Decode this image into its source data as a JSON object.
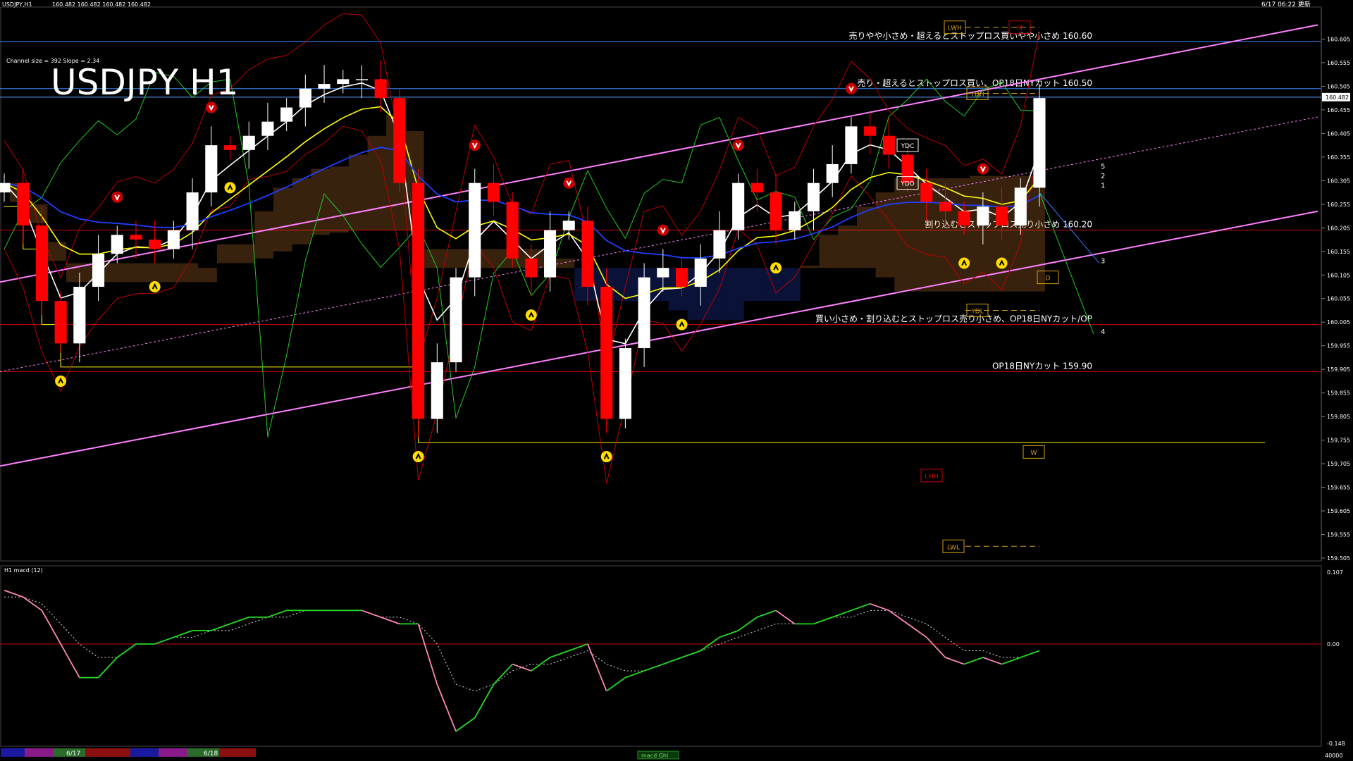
{
  "header": {
    "symbol_info": "USDJPY,H1",
    "ohlc": "160.482 160.482 160.482 160.482",
    "timestamp": "6/17 06:22 更新"
  },
  "main_title": "USDJPY H1",
  "channel_info": "Channel size = 392 Slope = 2.34",
  "colors": {
    "background": "#000000",
    "bull_candle": "#ffffff",
    "bear_candle": "#ff0000",
    "ema_fast": "#ffffff",
    "ema_slow": "#ffff00",
    "ema_long": "#1f3fff",
    "channel": "#ff80ff",
    "cloud_bear": "#ff9a40",
    "cloud_bull": "#3050ff",
    "chikou": "#22cc22",
    "level_line": "#cc0000",
    "macd_pos": "#22dd22",
    "macd_neg": "#ff88bb"
  },
  "chart_data": [
    {
      "type": "line",
      "title": "USDJPY H1",
      "ylim": [
        159.505,
        160.655
      ],
      "y_ticks": [
        "160.605",
        "160.555",
        "160.505",
        "160.455",
        "160.405",
        "160.355",
        "160.305",
        "160.255",
        "160.205",
        "160.155",
        "160.105",
        "160.055",
        "160.005",
        "159.955",
        "159.905",
        "159.855",
        "159.805",
        "159.755",
        "159.705",
        "159.655",
        "159.605",
        "159.555",
        "159.505"
      ],
      "current_price": "160.482",
      "x_labels": [
        "6/17",
        "6/18"
      ],
      "series": [
        {
          "values": [
            160.3,
            160.21,
            160.05,
            159.96,
            160.08,
            160.15,
            160.19,
            160.18,
            160.16,
            160.2,
            160.28,
            160.38,
            160.37,
            160.4,
            160.43,
            160.46,
            160.5,
            160.51,
            160.52,
            160.52,
            160.48,
            160.3,
            159.8,
            159.92,
            160.1,
            160.3,
            160.26,
            160.14,
            160.1,
            160.2,
            160.22,
            160.08,
            159.8,
            159.95,
            160.1,
            160.12,
            160.08,
            160.14,
            160.2,
            160.3,
            160.28,
            160.2,
            160.24,
            160.3,
            160.34,
            160.42,
            160.4,
            160.36,
            160.3,
            160.26,
            160.24,
            160.21,
            160.25,
            160.21,
            160.29,
            160.48
          ]
        }
      ],
      "levels": [
        {
          "label": "売りやや小さめ・超えるとストップロス買いやや小さめ 160.60",
          "value": 160.6
        },
        {
          "label": "売り・超えるとストップロス買い、OP18日NYカット 160.50",
          "value": 160.5
        },
        {
          "label": "割り込むとストップロス売り小さめ 160.20",
          "value": 160.2
        },
        {
          "label": "買い小さめ・割り込むとストップロス売り小さめ、OP18日NYカット/OP",
          "value": 160.0
        },
        {
          "label": "OP18日NYカット 159.90",
          "value": 159.9
        }
      ],
      "pivot_labels": [
        "LWH",
        "YDH",
        "YDC",
        "YDO",
        "YDL",
        "LMH",
        "LWL",
        "M",
        "W",
        "D"
      ],
      "wave_labels": [
        "5",
        "2",
        "1",
        "3",
        "4"
      ]
    },
    {
      "type": "line",
      "title": "H1 macd (12)",
      "ylim": [
        -0.148,
        0.107
      ],
      "y_ticks": [
        "0.107",
        "0.00",
        "-0.148"
      ],
      "series": [
        {
          "values": [
            0.08,
            0.07,
            0.05,
            0.0,
            -0.05,
            -0.05,
            -0.02,
            0.0,
            0.0,
            0.01,
            0.02,
            0.02,
            0.03,
            0.04,
            0.04,
            0.05,
            0.05,
            0.05,
            0.05,
            0.05,
            0.04,
            0.03,
            0.03,
            -0.06,
            -0.13,
            -0.11,
            -0.06,
            -0.03,
            -0.04,
            -0.02,
            -0.01,
            0.0,
            -0.07,
            -0.05,
            -0.04,
            -0.03,
            -0.02,
            -0.01,
            0.01,
            0.02,
            0.04,
            0.05,
            0.03,
            0.03,
            0.04,
            0.05,
            0.06,
            0.05,
            0.03,
            0.01,
            -0.02,
            -0.03,
            -0.02,
            -0.03,
            -0.02,
            -0.01
          ]
        },
        {
          "values": [
            0.07,
            0.07,
            0.06,
            0.03,
            0.0,
            -0.02,
            -0.02,
            0.0,
            0.0,
            0.01,
            0.01,
            0.02,
            0.02,
            0.03,
            0.04,
            0.04,
            0.05,
            0.05,
            0.05,
            0.05,
            0.04,
            0.04,
            0.03,
            0.0,
            -0.06,
            -0.07,
            -0.06,
            -0.04,
            -0.03,
            -0.03,
            -0.02,
            -0.01,
            -0.03,
            -0.04,
            -0.04,
            -0.03,
            -0.02,
            -0.01,
            0.0,
            0.01,
            0.02,
            0.03,
            0.03,
            0.03,
            0.04,
            0.04,
            0.05,
            0.05,
            0.04,
            0.03,
            0.01,
            -0.01,
            -0.01,
            -0.02,
            -0.02,
            -0.01
          ]
        }
      ]
    }
  ],
  "macd_panel_label": "H1 macd (12)",
  "bottom_label": "macd Ghl",
  "bottom_number": "40000"
}
